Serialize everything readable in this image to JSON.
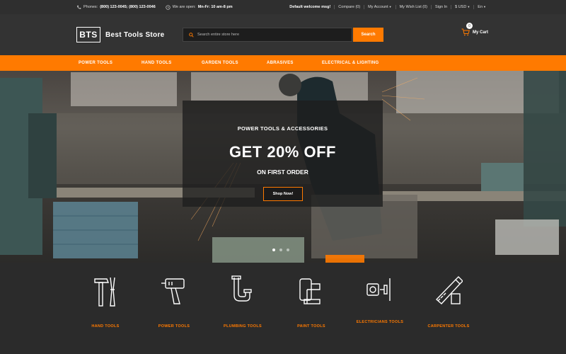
{
  "topbar": {
    "phones_label": "Phones:",
    "phones_value": "(800) 123-0045; (800) 123-0046",
    "hours_label": "We are open:",
    "hours_value": "Mn-Fr: 10 am-8 pm",
    "welcome": "Default welcome msg!",
    "compare": "Compare (0)",
    "my_account": "My Account",
    "wish_list": "My Wish List (0)",
    "sign_in": "Sign In",
    "currency": "$ USD",
    "language": "En"
  },
  "header": {
    "logo_short": "BTS",
    "logo_name": "Best Tools Store",
    "search_placeholder": "Search entire store here",
    "search_button": "Search",
    "cart_count": "0",
    "cart_label": "My Cart"
  },
  "nav": {
    "items": [
      "POWER TOOLS",
      "HAND TOOLS",
      "GARDEN TOOLS",
      "ABRASIVES",
      "ELECTRICAL & LIGHTING"
    ]
  },
  "hero": {
    "subtitle": "POWER TOOLS & ACCESSORIES",
    "title": "GET 20% OFF",
    "line": "ON FIRST ORDER",
    "button": "Shop Now!",
    "slide_count": 3,
    "active_slide": 1
  },
  "categories": [
    {
      "label": "HAND TOOLS",
      "icon": "hand-tools-icon"
    },
    {
      "label": "POWER TOOLS",
      "icon": "drill-icon"
    },
    {
      "label": "PLUMBING TOOLS",
      "icon": "pipe-icon"
    },
    {
      "label": "PAINT TOOLS",
      "icon": "paint-roller-icon"
    },
    {
      "label": "ELECTRICIANS TOOLS",
      "icon": "socket-plug-icon"
    },
    {
      "label": "CARPENTER TOOLS",
      "icon": "saw-icon"
    }
  ],
  "colors": {
    "accent": "#ff7a00",
    "dark": "#2b2b2b",
    "header": "#333333"
  }
}
